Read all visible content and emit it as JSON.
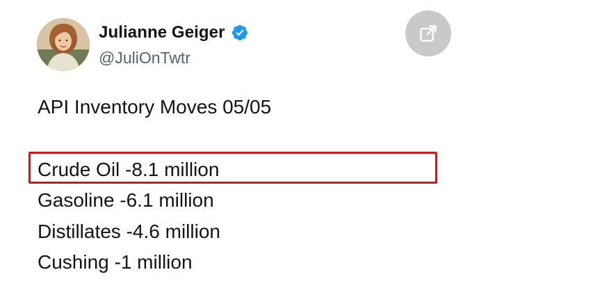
{
  "tweet": {
    "author": {
      "display_name": "Julianne Geiger",
      "handle": "@JuliOnTwtr",
      "verified": true,
      "avatar_icon": "profile-photo"
    },
    "expand_icon": "open-in-new-icon",
    "title_line": "API Inventory Moves 05/05",
    "lines": [
      "Crude Oil -8.1 million",
      "Gasoline -6.1 million",
      "Distillates -4.6 million",
      "Cushing -1 million"
    ],
    "highlighted_line_index": 0
  },
  "colors": {
    "text": "#0f1419",
    "secondary_text": "#536471",
    "verified_badge": "#1d9bf0",
    "highlight_border": "#c9191e",
    "expand_button_bg": "#c9c9c9"
  }
}
